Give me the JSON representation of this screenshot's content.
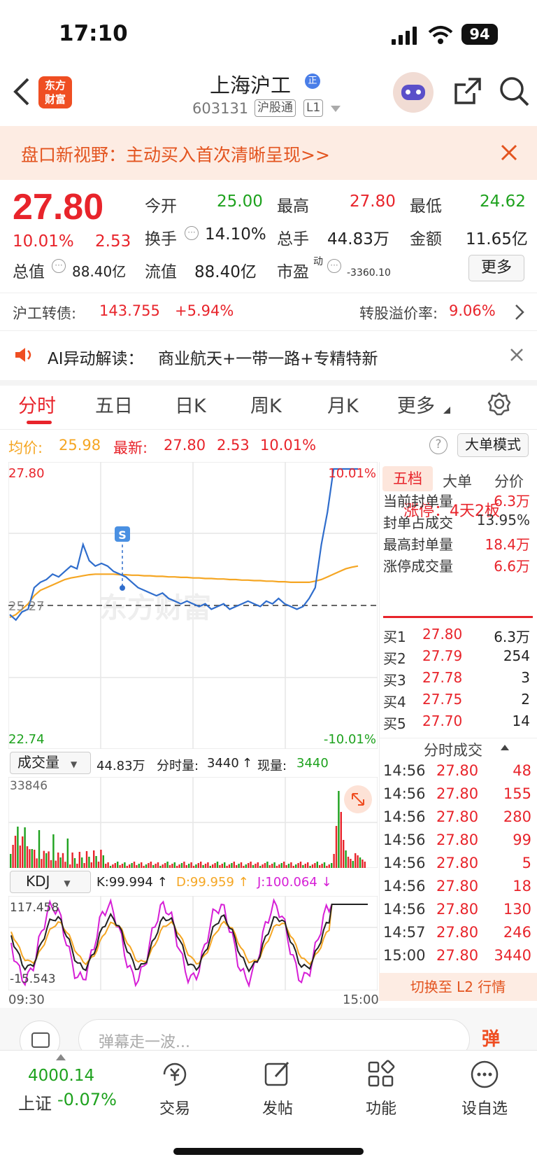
{
  "status": {
    "time": "17:10",
    "battery": "94"
  },
  "header": {
    "stock_name": "上海沪工",
    "stock_code": "603131",
    "tag1": "沪股通",
    "tag2": "L1",
    "logo_line1": "东方",
    "logo_line2": "财富",
    "badge": "正"
  },
  "banner": {
    "text": "盘口新视野：主动买入首次清晰呈现>>"
  },
  "quote": {
    "price": "27.80",
    "change_pct": "10.01%",
    "change": "2.53",
    "open_label": "今开",
    "open": "25.00",
    "high_label": "最高",
    "high": "27.80",
    "low_label": "最低",
    "low": "24.62",
    "turnover_label": "换手",
    "turnover": "14.10%",
    "volume_label": "总手",
    "volume": "44.83万",
    "amount_label": "金额",
    "amount": "11.65亿",
    "mktcap_label": "总值",
    "mktcap": "88.40亿",
    "float_label": "流值",
    "float": "88.40亿",
    "pe_label": "市盈",
    "pe_sup": "动",
    "pe": "-3360.10",
    "more": "更多"
  },
  "bond": {
    "label": "沪工转债:",
    "price": "143.755",
    "change": "+5.94%",
    "premium_label": "转股溢价率:",
    "premium": "9.06%"
  },
  "ai": {
    "label": "AI异动解读：",
    "text": "商业航天+一带一路+专精特新"
  },
  "tabs": [
    "分时",
    "五日",
    "日K",
    "周K",
    "月K",
    "更多"
  ],
  "chart_info": {
    "avg_label": "均价:",
    "avg": "25.98",
    "latest_label": "最新:",
    "latest": "27.80",
    "change": "2.53",
    "change_pct": "10.01%",
    "mode_button": "大单模式"
  },
  "chart_data": {
    "type": "line",
    "ylim": [
      22.74,
      27.8
    ],
    "y_top_label": "27.80",
    "y_mid_label": "25.27",
    "y_bottom_label": "22.74",
    "pct_top_label": "10.01%",
    "pct_bottom_label": "-10.01%",
    "x_start": "09:30",
    "x_end": "15:00",
    "marker": "S",
    "series": [
      {
        "values": [
          25.1,
          25.0,
          25.15,
          25.2,
          25.6,
          25.7,
          25.75,
          25.85,
          25.8,
          25.9,
          26.0,
          25.95,
          26.4,
          26.1,
          26.0,
          26.05,
          26.0,
          25.9,
          25.85,
          25.8,
          25.7,
          25.6,
          25.55,
          25.5,
          25.45,
          25.5,
          25.4,
          25.35,
          25.3,
          25.35,
          25.3,
          25.25,
          25.3,
          25.2,
          25.25,
          25.3,
          25.2,
          25.25,
          25.3,
          25.35,
          25.3,
          25.25,
          25.35,
          25.3,
          25.4,
          25.3,
          25.25,
          25.2,
          25.25,
          25.4,
          25.6,
          26.4,
          27.0,
          27.8,
          27.8,
          27.8,
          27.8,
          27.8
        ]
      },
      {
        "values": [
          25.05,
          25.1,
          25.2,
          25.3,
          25.45,
          25.55,
          25.6,
          25.65,
          25.7,
          25.75,
          25.78,
          25.8,
          25.82,
          25.84,
          25.85,
          25.85,
          25.85,
          25.85,
          25.84,
          25.84,
          25.83,
          25.83,
          25.82,
          25.82,
          25.81,
          25.81,
          25.8,
          25.8,
          25.79,
          25.79,
          25.78,
          25.78,
          25.77,
          25.77,
          25.76,
          25.76,
          25.75,
          25.75,
          25.74,
          25.74,
          25.73,
          25.73,
          25.72,
          25.72,
          25.71,
          25.71,
          25.7,
          25.7,
          25.7,
          25.7,
          25.72,
          25.75,
          25.8,
          25.85,
          25.9,
          25.95,
          25.98,
          26.0
        ]
      }
    ]
  },
  "volume": {
    "selector": "成交量",
    "total": "44.83万",
    "min_label": "分时量:",
    "min_vol": "3440",
    "cur_label": "现量:",
    "cur_vol": "3440",
    "max_label": "33846"
  },
  "kdj": {
    "selector": "KDJ",
    "k": "K:99.994 ↑",
    "d": "D:99.959 ↑",
    "j": "J:100.064 ↓",
    "max_label": "117.458",
    "min_label": "-15.543"
  },
  "right_panel": {
    "tabs": [
      "五档",
      "大单",
      "分价"
    ],
    "limit": "涨停：4天2板",
    "stats": [
      {
        "label": "当前封单量",
        "value": "6.3万"
      },
      {
        "label": "封单占成交",
        "value": "13.95%"
      },
      {
        "label": "最高封单量",
        "value": "18.4万"
      },
      {
        "label": "涨停成交量",
        "value": "6.6万"
      }
    ],
    "bids": [
      {
        "label": "买1",
        "price": "27.80",
        "vol": "6.3万"
      },
      {
        "label": "买2",
        "price": "27.79",
        "vol": "254"
      },
      {
        "label": "买3",
        "price": "27.78",
        "vol": "3"
      },
      {
        "label": "买4",
        "price": "27.75",
        "vol": "2"
      },
      {
        "label": "买5",
        "price": "27.70",
        "vol": "14"
      }
    ],
    "ticks_title": "分时成交",
    "ticks": [
      {
        "time": "14:56",
        "price": "27.80",
        "vol": "48"
      },
      {
        "time": "14:56",
        "price": "27.80",
        "vol": "155"
      },
      {
        "time": "14:56",
        "price": "27.80",
        "vol": "280"
      },
      {
        "time": "14:56",
        "price": "27.80",
        "vol": "99"
      },
      {
        "time": "14:56",
        "price": "27.80",
        "vol": "5"
      },
      {
        "time": "14:56",
        "price": "27.80",
        "vol": "18"
      },
      {
        "time": "14:56",
        "price": "27.80",
        "vol": "130"
      },
      {
        "time": "14:57",
        "price": "27.80",
        "vol": "246"
      },
      {
        "time": "15:00",
        "price": "27.80",
        "vol": "3440"
      }
    ],
    "l2_button": "切换至 L2 行情"
  },
  "danmu": {
    "placeholder": "弹幕走一波...",
    "send": "弹"
  },
  "bottom": {
    "index_value": "4000.14",
    "index_name": "上证",
    "index_change": "-0.07%",
    "items": [
      "交易",
      "发帖",
      "功能",
      "设自选"
    ]
  }
}
